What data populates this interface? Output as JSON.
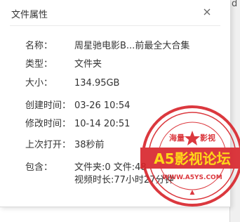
{
  "dialog": {
    "title": "文件属性",
    "close_icon": "close-icon"
  },
  "background": {
    "glyph": "d"
  },
  "properties": [
    {
      "label": "名称：",
      "value": "周星驰电影B...前最全大合集"
    },
    {
      "label": "类型：",
      "value": "文件夹"
    },
    {
      "label": "大小：",
      "value": "134.95GB"
    },
    {
      "label": "创建时间：",
      "value": "03-26 10:54"
    },
    {
      "label": "修改时间：",
      "value": "10-14 20:51"
    },
    {
      "label": "上次打开：",
      "value": "38秒前"
    },
    {
      "label": "包含：",
      "value": "文件夹:0 文件:48",
      "value2": "视频时长:77小时27分钟"
    }
  ],
  "watermark": {
    "top_text": "海量",
    "top_text_right": "影视",
    "brand": "A5影视论坛",
    "url": "WWW.A5YS.COM",
    "colors": {
      "red": "#d8232a",
      "yellow": "#ffd400"
    }
  }
}
